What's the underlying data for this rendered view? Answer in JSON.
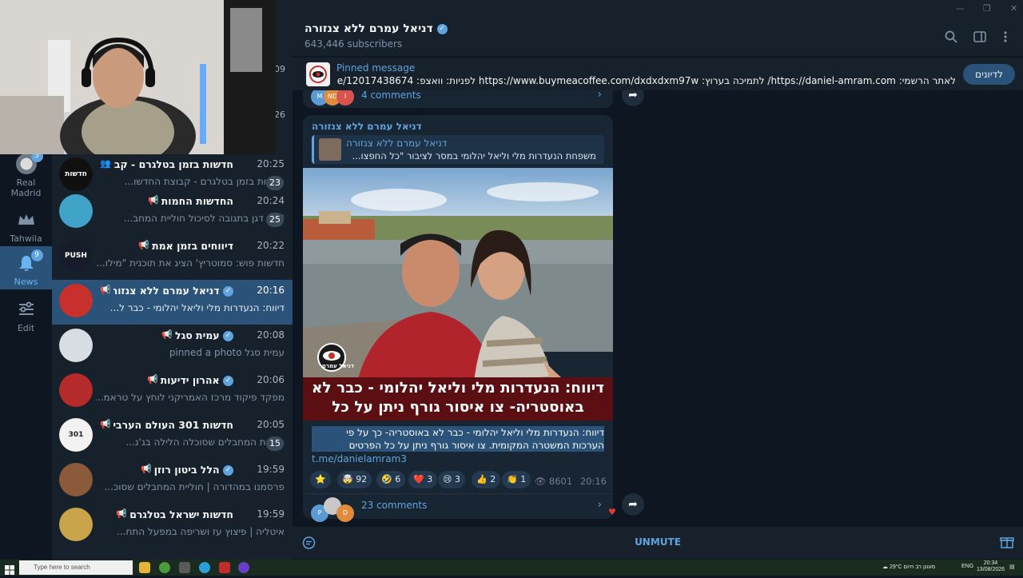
{
  "colors": {
    "accent": "#5fa4df",
    "active_item": "#2b5278",
    "bg_dark": "#0e1621",
    "panel": "#17212b",
    "bubble": "#182533"
  },
  "folders": [
    {
      "label": "Real Madrid",
      "badge": "5",
      "icon": "real-madrid-crest-icon"
    },
    {
      "label": "Tahwila",
      "badge": "",
      "icon": "crown-icon"
    },
    {
      "label": "News",
      "badge": "9",
      "icon": "bell-icon"
    },
    {
      "label": "Edit",
      "badge": "",
      "icon": "sliders-icon"
    }
  ],
  "chats": [
    {
      "name": "חדשות בזמן בטלגרם - קבוצת ...",
      "time": "20:25",
      "preview": "חדשות בזמן בטלגרם - קבוצת החדשו...",
      "unread": "23",
      "avatar_text": "חדשות בזמן",
      "avatar_color": "#101010",
      "icon": "group-icon"
    },
    {
      "name": "החדשות החמות",
      "time": "20:24",
      "preview": "*יוסי דגן בתגובה לסיכול חוליית המחב...",
      "unread": "25",
      "avatar_text": "",
      "avatar_color": "#3fa4c8",
      "icon": "megaphone-icon"
    },
    {
      "name": "דיווחים בזמן אמת",
      "time": "20:22",
      "preview": "חדשות פוש: סמוטריץ' הציג את תוכנית \"מילו...",
      "unread": "",
      "avatar_text": "PUSH",
      "avatar_color": "#161c2a",
      "icon": "megaphone-icon"
    },
    {
      "name": "דניאל עמרם ללא צנזורה",
      "time": "20:16",
      "preview": "דיווח: הנעדרות מלי וליאל יהלומי - כבר ל...",
      "unread": "",
      "avatar_text": "",
      "avatar_color": "#c7302c",
      "icon": "megaphone-icon",
      "verified": true,
      "active": true
    },
    {
      "name": "עמית סגל",
      "time": "20:08",
      "preview": "עמית סגל pinned a photo",
      "unread": "",
      "avatar_text": "",
      "avatar_color": "#d8dde3",
      "icon": "megaphone-icon",
      "verified": true
    },
    {
      "name": "אהרון ידיעות",
      "time": "20:06",
      "preview": "מפקד פיקוד מרכז האמריקני לוחץ על טראמ...",
      "unread": "",
      "avatar_text": "",
      "avatar_color": "#b52a2a",
      "icon": "megaphone-icon",
      "verified": true
    },
    {
      "name": "חדשות 301 העולם הערבי",
      "time": "20:05",
      "preview": "חוליית המחבלים שסוכלה הלילה בג'נ...",
      "unread": "15",
      "avatar_text": "301",
      "avatar_color": "#f2f2f2",
      "icon": "megaphone-icon"
    },
    {
      "name": "הלל ביטון רוזן",
      "time": "19:59",
      "preview": "פרסמנו במהדורה | חוליית המחבלים שסוכ...",
      "unread": "",
      "avatar_text": "",
      "avatar_color": "#8a5a3a",
      "icon": "megaphone-icon",
      "verified": true
    },
    {
      "name": "חדשות ישראל בטלגרם",
      "time": "19:59",
      "preview": "איטליה | פיצוץ עז ושריפה במפעל התח...",
      "unread": "",
      "avatar_text": "",
      "avatar_color": "#c9a44a",
      "icon": "megaphone-icon"
    }
  ],
  "header": {
    "title": "דניאל עמרם ללא צנזורה",
    "subscribers": "643,446 subscribers"
  },
  "pinned": {
    "label": "Pinned message",
    "text": "לאתר הרשמי: https://daniel-amram.com/ לתמיכה בערוץ: https://www.buymeacoffee.com/dxdxdxm97w לפניות: וואצפ: wa.me/12017438674 ...",
    "button": "לדיונים"
  },
  "prev_post": {
    "comments": "4 comments",
    "avatars": [
      "M",
      "ND",
      "I"
    ]
  },
  "post": {
    "channel": "דניאל עמרם ללא צנזורה",
    "reply_name": "דניאל עמרם ללא צנזורה",
    "reply_text": "משפחת הנעדרות מלי וליאל יהלומי במסר לציבור \"כל החפצו...",
    "image_caption": "דיווח: הנעדרות מלי וליאל יהלומי - כבר לא באוסטריה- צו איסור גורף ניתן על כל הפרטים",
    "watermark": "דניאל עמרם",
    "text": "דיווח: הנעדרות מלי וליאל יהלומי - כבר לא באוסטריה- כך על פי הערכות המשטרה המקומית. צו איסור גורף ניתן על כל הפרטים",
    "link": "t.me/danielamram3",
    "reactions": [
      {
        "emoji": "⭐",
        "count": ""
      },
      {
        "emoji": "🤯",
        "count": "92"
      },
      {
        "emoji": "🤣",
        "count": "6"
      },
      {
        "emoji": "❤️",
        "count": "3"
      },
      {
        "emoji": "😢",
        "count": "3"
      },
      {
        "emoji": "👍",
        "count": "2"
      },
      {
        "emoji": "👏",
        "count": "1"
      }
    ],
    "views": "8601",
    "time": "20:16",
    "comments": "23 comments",
    "comment_avatars": [
      "P",
      "",
      "D"
    ]
  },
  "bottom": {
    "unmute": "UNMUTE"
  },
  "taskbar": {
    "search_placeholder": "Type here to search",
    "weather": "29°C",
    "weather_text": "מעונן רב היום",
    "lang": "ENG",
    "clock_time": "20:34",
    "clock_date": "13/08/2026"
  },
  "sidebar_partial_numbers": [
    "09",
    "26"
  ]
}
